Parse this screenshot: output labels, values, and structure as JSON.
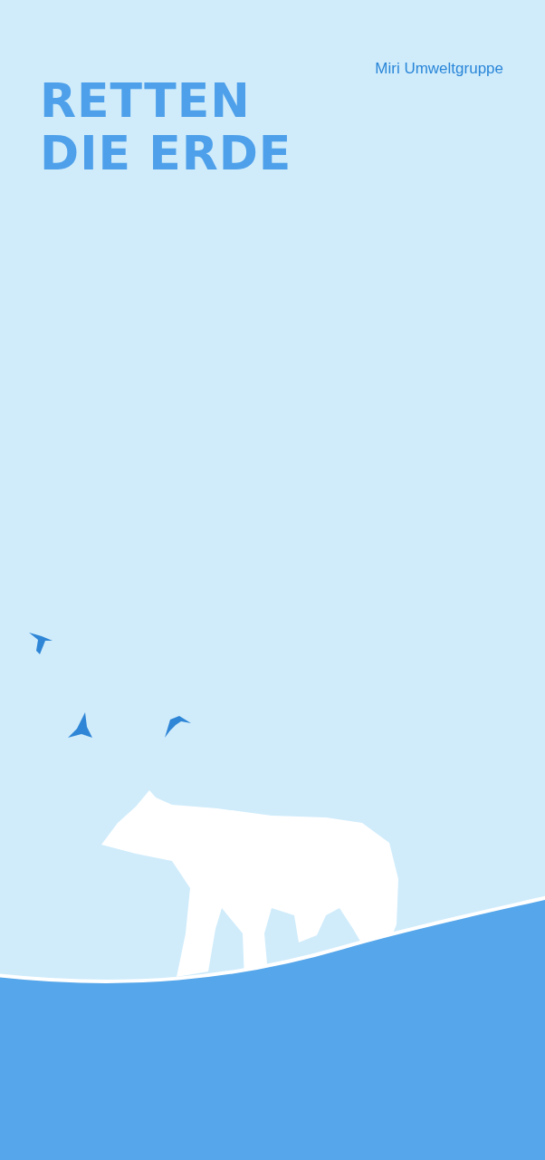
{
  "brand": "Miri Umweltgruppe",
  "headline": [
    "RETTEN",
    "DIE ERDE"
  ]
}
